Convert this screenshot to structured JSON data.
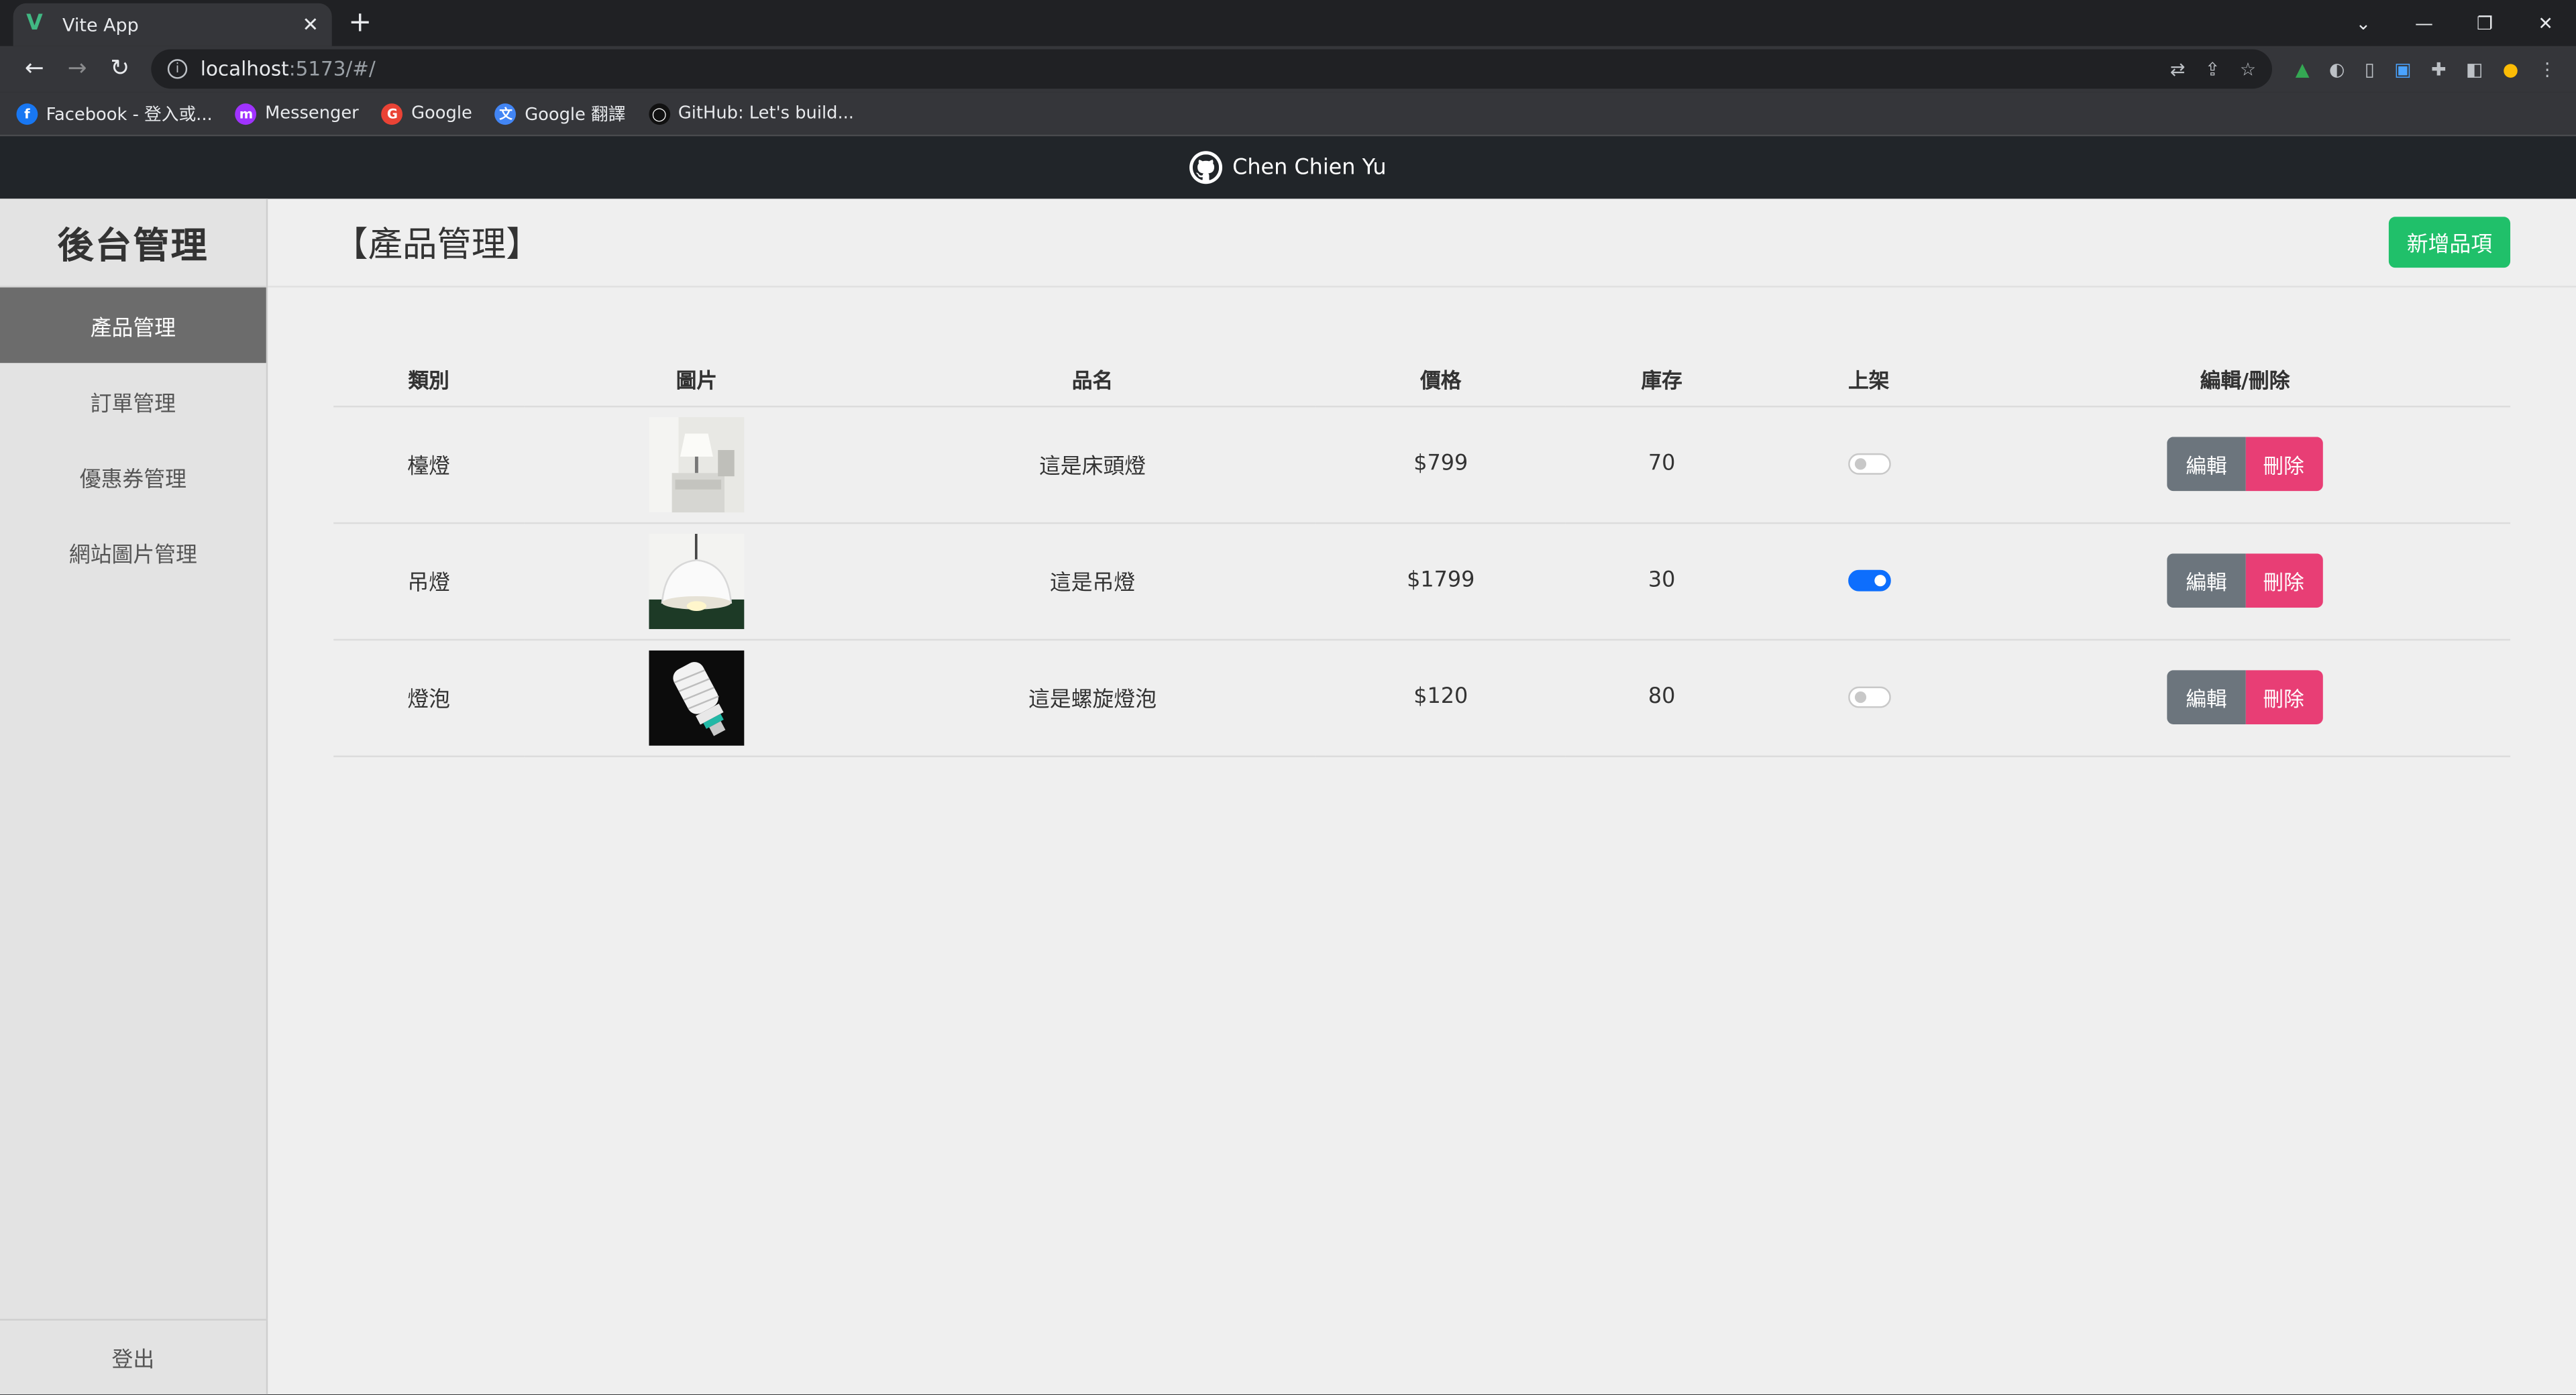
{
  "browser": {
    "tab_title": "Vite App",
    "url_host": "localhost",
    "url_rest": ":5173/#/",
    "bookmarks": [
      {
        "label": "Facebook - 登入或...",
        "color": "#1877f2",
        "glyph": "f"
      },
      {
        "label": "Messenger",
        "color": "#a033ff",
        "glyph": "m"
      },
      {
        "label": "Google",
        "color": "#ea4335",
        "glyph": "G"
      },
      {
        "label": "Google 翻譯",
        "color": "#4285f4",
        "glyph": "文"
      },
      {
        "label": "GitHub: Let's build...",
        "color": "#111111",
        "glyph": "◯"
      }
    ]
  },
  "appbar": {
    "author": "Chen Chien Yu",
    "icon": "github-icon"
  },
  "sidebar": {
    "brand": "後台管理",
    "items": [
      "產品管理",
      "訂單管理",
      "優惠券管理",
      "網站圖片管理"
    ],
    "active_index": 0,
    "logout": "登出"
  },
  "main": {
    "title": "【產品管理】",
    "add_button": "新增品項",
    "columns": [
      "類別",
      "圖片",
      "品名",
      "價格",
      "庫存",
      "上架",
      "編輯/刪除"
    ],
    "edit_label": "編輯",
    "delete_label": "刪除",
    "rows": [
      {
        "category": "檯燈",
        "image": "table-lamp-photo",
        "name": "這是床頭燈",
        "price": "$799",
        "stock": "70",
        "enabled": false
      },
      {
        "category": "吊燈",
        "image": "pendant-lamp-photo",
        "name": "這是吊燈",
        "price": "$1799",
        "stock": "30",
        "enabled": true
      },
      {
        "category": "燈泡",
        "image": "spiral-bulb-photo",
        "name": "這是螺旋燈泡",
        "price": "$120",
        "stock": "80",
        "enabled": false
      }
    ]
  },
  "colors": {
    "add_button": "#20c06a",
    "edit_button": "#6c757d",
    "delete_button": "#e83e75",
    "toggle_on": "#0d6efd"
  }
}
